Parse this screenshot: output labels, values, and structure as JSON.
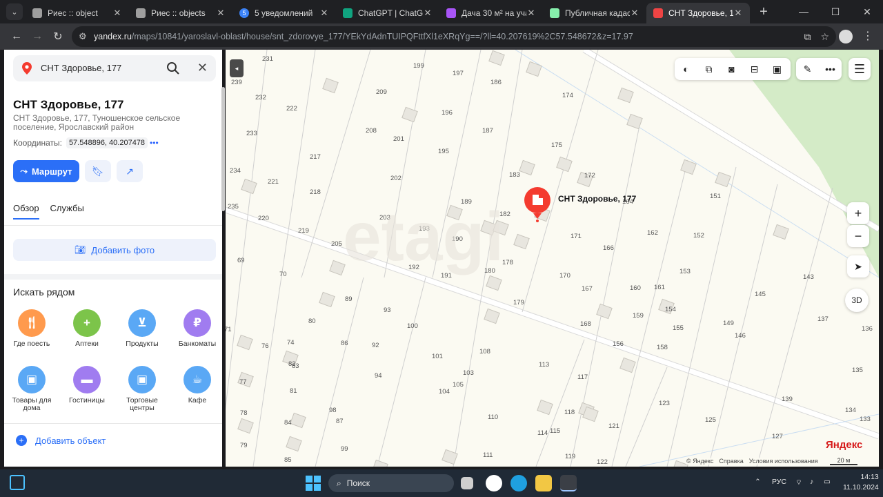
{
  "browser": {
    "tabs": [
      {
        "title": "Риес :: object",
        "favicon": "grid-favicon-icon",
        "color": "#9e9e9e"
      },
      {
        "title": "Риес :: objects",
        "favicon": "grid-favicon-icon",
        "color": "#9e9e9e"
      },
      {
        "title": "5 уведомлений",
        "favicon": "notification-badge-icon",
        "color": "#3b82f6",
        "badge": "5"
      },
      {
        "title": "ChatGPT | ChatGPT 4",
        "favicon": "chatgpt-icon",
        "color": "#10a37f"
      },
      {
        "title": "Дача 30 м² на участ",
        "favicon": "avito-icon",
        "color": "#a855f7"
      },
      {
        "title": "Публичная кадастр",
        "favicon": "cadastre-icon",
        "color": "#86efac"
      },
      {
        "title": "СНТ Здоровье, 177",
        "favicon": "yandex-maps-pin-icon",
        "color": "#ef4444",
        "active": true
      }
    ],
    "url": "yandex.ru",
    "url_path": "/maps/10841/yaroslavl-oblast/house/snt_zdorovye_177/YEkYdAdnTUIPQFttfXl1eXRqYg==/?ll=40.207619%2C57.548672&z=17.97"
  },
  "panel": {
    "search_value": "СНТ Здоровье, 177",
    "title": "СНТ Здоровье, 177",
    "address": "СНТ Здоровье, 177, Туношенское сельское поселение, Ярославский район",
    "coords_label": "Координаты:",
    "coords_value": "57.548896, 40.207478",
    "route_label": "Маршрут",
    "tab_overview": "Обзор",
    "tab_services": "Службы",
    "add_photo": "Добавить фото",
    "nearby_title": "Искать рядом",
    "categories": [
      {
        "label": "Где поесть",
        "color": "#ff9a4d",
        "icon": "fork-knife-icon"
      },
      {
        "label": "Аптеки",
        "color": "#7cc44a",
        "icon": "pharmacy-cross-icon"
      },
      {
        "label": "Продукты",
        "color": "#5aa8f5",
        "icon": "basket-icon"
      },
      {
        "label": "Банкоматы",
        "color": "#a07cf0",
        "icon": "ruble-icon"
      },
      {
        "label": "Товары для дома",
        "color": "#5aa8f5",
        "icon": "shopping-bag-icon"
      },
      {
        "label": "Гостиницы",
        "color": "#a07cf0",
        "icon": "bed-icon"
      },
      {
        "label": "Торговые центры",
        "color": "#5aa8f5",
        "icon": "shopping-bag-icon"
      },
      {
        "label": "Кафе",
        "color": "#5aa8f5",
        "icon": "coffee-cup-icon"
      }
    ],
    "add_object": "Добавить объект"
  },
  "map": {
    "marker_label": "СНТ Здоровье, 177",
    "button_3d": "3D",
    "logo": "Яндекс",
    "copyright": "© Яндекс",
    "help": "Справка",
    "terms": "Условия использования",
    "scale": "20 м",
    "watermark": "etagi",
    "plot_numbers": [
      "231",
      "232",
      "233",
      "234",
      "235",
      "222",
      "221",
      "220",
      "217",
      "218",
      "219",
      "209",
      "208",
      "203",
      "202",
      "201",
      "205",
      "199",
      "197",
      "196",
      "195",
      "193",
      "192",
      "191",
      "190",
      "189",
      "187",
      "186",
      "183",
      "182",
      "180",
      "178",
      "179",
      "175",
      "174",
      "172",
      "171",
      "170",
      "168",
      "167",
      "166",
      "164",
      "162",
      "161",
      "160",
      "159",
      "158",
      "156",
      "155",
      "154",
      "153",
      "152",
      "151",
      "149",
      "146",
      "145",
      "143",
      "139",
      "137",
      "136",
      "135",
      "134",
      "133",
      "127",
      "125",
      "123",
      "122",
      "121",
      "119",
      "118",
      "117",
      "115",
      "114",
      "113",
      "111",
      "110",
      "108",
      "105",
      "104",
      "103",
      "101",
      "100",
      "99",
      "98",
      "94",
      "93",
      "92",
      "89",
      "87",
      "86",
      "85",
      "84",
      "83",
      "82",
      "81",
      "80",
      "79",
      "78",
      "77",
      "76",
      "74",
      "70",
      "69",
      "239",
      "71"
    ]
  },
  "taskbar": {
    "search": "Поиск",
    "lang": "РУС",
    "time": "14:13",
    "date": "11.10.2024"
  },
  "colors": {
    "accent": "#2b6ff7",
    "marker": "#f43b2f",
    "map_bg": "#fbfaf2"
  }
}
